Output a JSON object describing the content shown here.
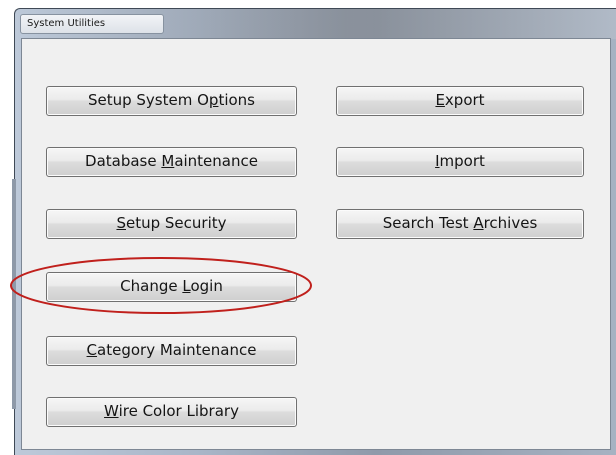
{
  "window": {
    "title": "System Utilities"
  },
  "buttons": {
    "setup_system_options": {
      "pre": "Setup System O",
      "key": "p",
      "post": "tions"
    },
    "export": {
      "pre": "",
      "key": "E",
      "post": "xport"
    },
    "database_maintenance": {
      "pre": "Database ",
      "key": "M",
      "post": "aintenance"
    },
    "import": {
      "pre": "",
      "key": "I",
      "post": "mport"
    },
    "setup_security": {
      "pre": "",
      "key": "S",
      "post": "etup Security"
    },
    "search_test_archives": {
      "pre": "Search Test ",
      "key": "A",
      "post": "rchives"
    },
    "change_login": {
      "pre": "Change ",
      "key": "L",
      "post": "ogin"
    },
    "category_maintenance": {
      "pre": "",
      "key": "C",
      "post": "ategory Maintenance"
    },
    "wire_color_library": {
      "pre": "",
      "key": "W",
      "post": "ire Color Library"
    }
  },
  "annotation": {
    "highlight_color": "#c0201c",
    "highlighted_button": "Change Login"
  }
}
